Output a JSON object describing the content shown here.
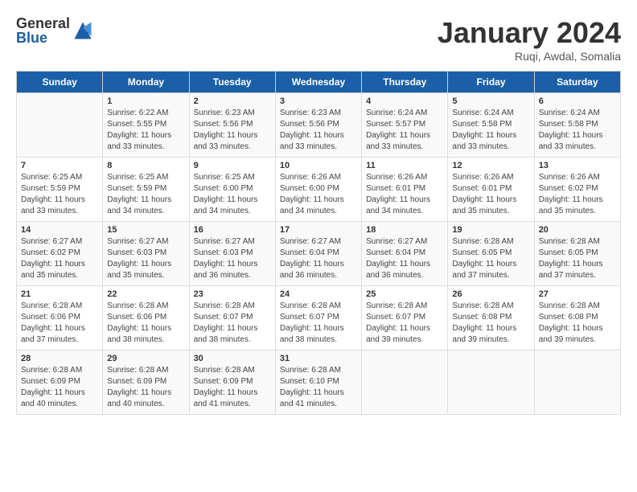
{
  "header": {
    "logo_general": "General",
    "logo_blue": "Blue",
    "month": "January 2024",
    "location": "Ruqi, Awdal, Somalia"
  },
  "weekdays": [
    "Sunday",
    "Monday",
    "Tuesday",
    "Wednesday",
    "Thursday",
    "Friday",
    "Saturday"
  ],
  "weeks": [
    [
      {
        "day": "",
        "info": ""
      },
      {
        "day": "1",
        "info": "Sunrise: 6:22 AM\nSunset: 5:55 PM\nDaylight: 11 hours\nand 33 minutes."
      },
      {
        "day": "2",
        "info": "Sunrise: 6:23 AM\nSunset: 5:56 PM\nDaylight: 11 hours\nand 33 minutes."
      },
      {
        "day": "3",
        "info": "Sunrise: 6:23 AM\nSunset: 5:56 PM\nDaylight: 11 hours\nand 33 minutes."
      },
      {
        "day": "4",
        "info": "Sunrise: 6:24 AM\nSunset: 5:57 PM\nDaylight: 11 hours\nand 33 minutes."
      },
      {
        "day": "5",
        "info": "Sunrise: 6:24 AM\nSunset: 5:58 PM\nDaylight: 11 hours\nand 33 minutes."
      },
      {
        "day": "6",
        "info": "Sunrise: 6:24 AM\nSunset: 5:58 PM\nDaylight: 11 hours\nand 33 minutes."
      }
    ],
    [
      {
        "day": "7",
        "info": "Sunrise: 6:25 AM\nSunset: 5:59 PM\nDaylight: 11 hours\nand 33 minutes."
      },
      {
        "day": "8",
        "info": "Sunrise: 6:25 AM\nSunset: 5:59 PM\nDaylight: 11 hours\nand 34 minutes."
      },
      {
        "day": "9",
        "info": "Sunrise: 6:25 AM\nSunset: 6:00 PM\nDaylight: 11 hours\nand 34 minutes."
      },
      {
        "day": "10",
        "info": "Sunrise: 6:26 AM\nSunset: 6:00 PM\nDaylight: 11 hours\nand 34 minutes."
      },
      {
        "day": "11",
        "info": "Sunrise: 6:26 AM\nSunset: 6:01 PM\nDaylight: 11 hours\nand 34 minutes."
      },
      {
        "day": "12",
        "info": "Sunrise: 6:26 AM\nSunset: 6:01 PM\nDaylight: 11 hours\nand 35 minutes."
      },
      {
        "day": "13",
        "info": "Sunrise: 6:26 AM\nSunset: 6:02 PM\nDaylight: 11 hours\nand 35 minutes."
      }
    ],
    [
      {
        "day": "14",
        "info": "Sunrise: 6:27 AM\nSunset: 6:02 PM\nDaylight: 11 hours\nand 35 minutes."
      },
      {
        "day": "15",
        "info": "Sunrise: 6:27 AM\nSunset: 6:03 PM\nDaylight: 11 hours\nand 35 minutes."
      },
      {
        "day": "16",
        "info": "Sunrise: 6:27 AM\nSunset: 6:03 PM\nDaylight: 11 hours\nand 36 minutes."
      },
      {
        "day": "17",
        "info": "Sunrise: 6:27 AM\nSunset: 6:04 PM\nDaylight: 11 hours\nand 36 minutes."
      },
      {
        "day": "18",
        "info": "Sunrise: 6:27 AM\nSunset: 6:04 PM\nDaylight: 11 hours\nand 36 minutes."
      },
      {
        "day": "19",
        "info": "Sunrise: 6:28 AM\nSunset: 6:05 PM\nDaylight: 11 hours\nand 37 minutes."
      },
      {
        "day": "20",
        "info": "Sunrise: 6:28 AM\nSunset: 6:05 PM\nDaylight: 11 hours\nand 37 minutes."
      }
    ],
    [
      {
        "day": "21",
        "info": "Sunrise: 6:28 AM\nSunset: 6:06 PM\nDaylight: 11 hours\nand 37 minutes."
      },
      {
        "day": "22",
        "info": "Sunrise: 6:28 AM\nSunset: 6:06 PM\nDaylight: 11 hours\nand 38 minutes."
      },
      {
        "day": "23",
        "info": "Sunrise: 6:28 AM\nSunset: 6:07 PM\nDaylight: 11 hours\nand 38 minutes."
      },
      {
        "day": "24",
        "info": "Sunrise: 6:28 AM\nSunset: 6:07 PM\nDaylight: 11 hours\nand 38 minutes."
      },
      {
        "day": "25",
        "info": "Sunrise: 6:28 AM\nSunset: 6:07 PM\nDaylight: 11 hours\nand 39 minutes."
      },
      {
        "day": "26",
        "info": "Sunrise: 6:28 AM\nSunset: 6:08 PM\nDaylight: 11 hours\nand 39 minutes."
      },
      {
        "day": "27",
        "info": "Sunrise: 6:28 AM\nSunset: 6:08 PM\nDaylight: 11 hours\nand 39 minutes."
      }
    ],
    [
      {
        "day": "28",
        "info": "Sunrise: 6:28 AM\nSunset: 6:09 PM\nDaylight: 11 hours\nand 40 minutes."
      },
      {
        "day": "29",
        "info": "Sunrise: 6:28 AM\nSunset: 6:09 PM\nDaylight: 11 hours\nand 40 minutes."
      },
      {
        "day": "30",
        "info": "Sunrise: 6:28 AM\nSunset: 6:09 PM\nDaylight: 11 hours\nand 41 minutes."
      },
      {
        "day": "31",
        "info": "Sunrise: 6:28 AM\nSunset: 6:10 PM\nDaylight: 11 hours\nand 41 minutes."
      },
      {
        "day": "",
        "info": ""
      },
      {
        "day": "",
        "info": ""
      },
      {
        "day": "",
        "info": ""
      }
    ]
  ]
}
